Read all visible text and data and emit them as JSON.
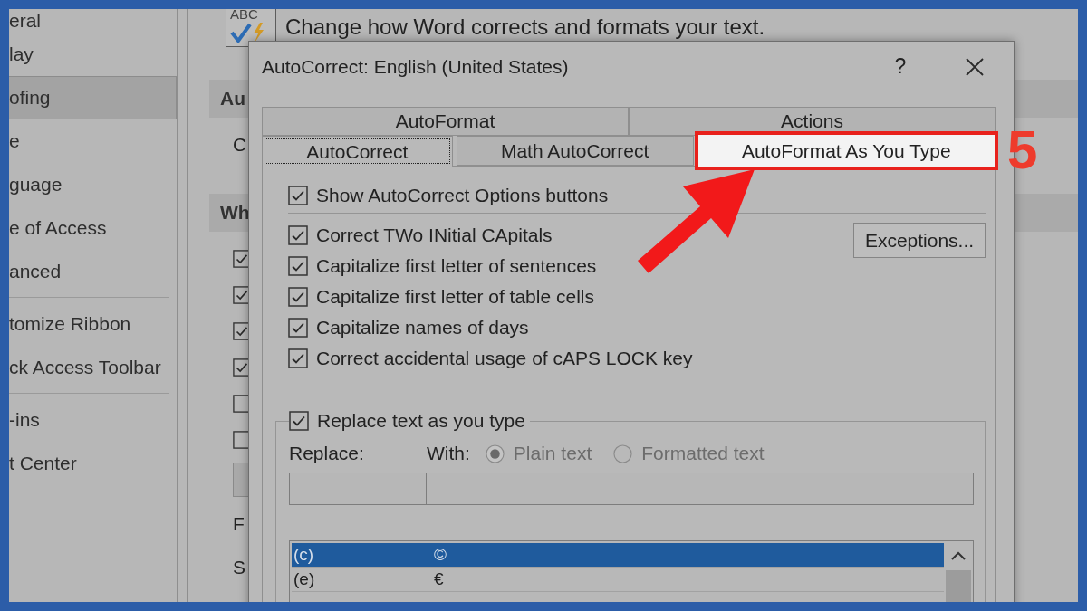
{
  "background_window": {
    "sidebar": {
      "groups": [
        {
          "items": [
            {
              "label": "eral",
              "selected": false
            },
            {
              "label": "lay",
              "selected": false
            },
            {
              "label": "ofing",
              "selected": true
            },
            {
              "label": "e",
              "selected": false
            },
            {
              "label": "guage",
              "selected": false
            },
            {
              "label": "e of Access",
              "selected": false
            },
            {
              "label": "anced",
              "selected": false
            }
          ]
        },
        {
          "items": [
            {
              "label": "tomize Ribbon",
              "selected": false
            },
            {
              "label": "ck Access Toolbar",
              "selected": false
            }
          ]
        },
        {
          "items": [
            {
              "label": "-ins",
              "selected": false
            },
            {
              "label": "t Center",
              "selected": false
            }
          ]
        }
      ]
    },
    "intro_icon_text": "ABC",
    "intro_text": "Change how Word corrects and formats your text.",
    "content": [
      {
        "kind": "heading",
        "text": "Au"
      },
      {
        "kind": "label",
        "text": "C"
      },
      {
        "kind": "heading",
        "text": "Wh"
      },
      {
        "kind": "checkbox",
        "checked": true
      },
      {
        "kind": "checkbox",
        "checked": true
      },
      {
        "kind": "checkbox",
        "checked": true
      },
      {
        "kind": "checkbox",
        "checked": true
      },
      {
        "kind": "checkbox",
        "checked": false
      },
      {
        "kind": "checkbox",
        "checked": false
      },
      {
        "kind": "button"
      },
      {
        "kind": "label",
        "text": "F"
      },
      {
        "kind": "label",
        "text": "S"
      }
    ]
  },
  "dialog": {
    "title": "AutoCorrect: English (United States)",
    "help_button": "?",
    "tab_rows": [
      {
        "tabs": [
          {
            "label": "AutoFormat",
            "selected": false,
            "highlighted": false
          },
          {
            "label": "Actions",
            "selected": false,
            "highlighted": false
          }
        ]
      },
      {
        "tabs": [
          {
            "label": "AutoCorrect",
            "selected": true,
            "highlighted": false
          },
          {
            "label": "Math AutoCorrect",
            "selected": false,
            "highlighted": false
          },
          {
            "label": "AutoFormat As You Type",
            "selected": false,
            "highlighted": true
          }
        ]
      }
    ],
    "show_options_buttons": {
      "label": "Show AutoCorrect Options buttons",
      "checked": true
    },
    "options": [
      {
        "label": "Correct TWo INitial CApitals",
        "checked": true
      },
      {
        "label": "Capitalize first letter of sentences",
        "checked": true
      },
      {
        "label": "Capitalize first letter of table cells",
        "checked": true
      },
      {
        "label": "Capitalize names of days",
        "checked": true
      },
      {
        "label": "Correct accidental usage of cAPS LOCK key",
        "checked": true
      }
    ],
    "exceptions_button": "Exceptions...",
    "replace_group": {
      "checkbox": {
        "label": "Replace text as you type",
        "checked": true
      },
      "replace_label": "Replace:",
      "with_label": "With:",
      "format_options": [
        {
          "label": "Plain text",
          "selected": true,
          "disabled": true
        },
        {
          "label": "Formatted text",
          "selected": false,
          "disabled": true
        }
      ],
      "entries": [
        {
          "replace": "(c)",
          "with": "©",
          "selected": true
        },
        {
          "replace": "(e)",
          "with": "€",
          "selected": false
        }
      ]
    }
  },
  "annotation": {
    "step_number": "5"
  }
}
